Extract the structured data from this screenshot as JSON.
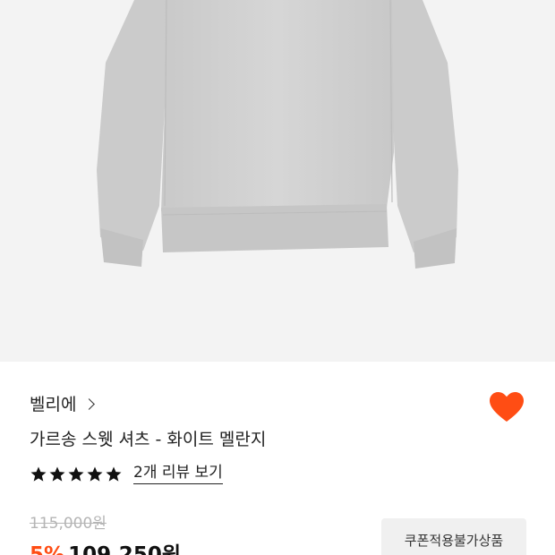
{
  "product": {
    "brand": "벨리에",
    "name": "가르송 스웻 셔츠 - 화이트 멜란지",
    "review_link": "2개 리뷰 보기",
    "rating_stars": 5,
    "original_price": "115,000원",
    "discount": "5%",
    "sale_price": "109,250원",
    "coupon_badge": "쿠폰적용불가상품"
  },
  "icons": {
    "brand_chevron": "chevron-right-icon",
    "wishlist": "heart-icon",
    "star": "star-icon"
  },
  "colors": {
    "accent": "#ff4d14",
    "image_background": "#f3f3f3",
    "strikethrough_price": "#b5b5b5"
  }
}
